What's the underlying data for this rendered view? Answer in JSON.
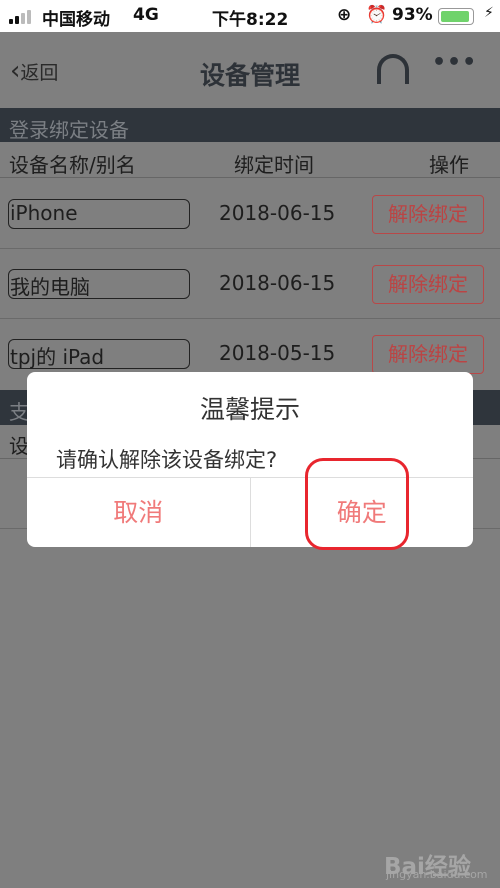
{
  "status": {
    "carrier": "中国移动",
    "network": "4G",
    "time": "下午8:22",
    "battery": "93%",
    "battery_level": 0.93
  },
  "nav": {
    "back": "返回",
    "title": "设备管理"
  },
  "section1": {
    "title": "登录绑定设备",
    "columns": [
      "设备名称/别名",
      "绑定时间",
      "操作"
    ],
    "rows": [
      {
        "name": "iPhone",
        "date": "2018-06-15",
        "action": "解除绑定"
      },
      {
        "name": "我的电脑",
        "date": "2018-06-15",
        "action": "解除绑定"
      },
      {
        "name": "tpj的 iPad",
        "date": "2018-05-15",
        "action": "解除绑定"
      }
    ]
  },
  "section2": {
    "title_partial": "支",
    "row_partial": "设"
  },
  "dialog": {
    "title": "温馨提示",
    "message": "请确认解除该设备绑定?",
    "cancel": "取消",
    "confirm": "确定"
  },
  "watermark": {
    "brand": "Bai经验",
    "url": "jingyan.baidu.com"
  }
}
